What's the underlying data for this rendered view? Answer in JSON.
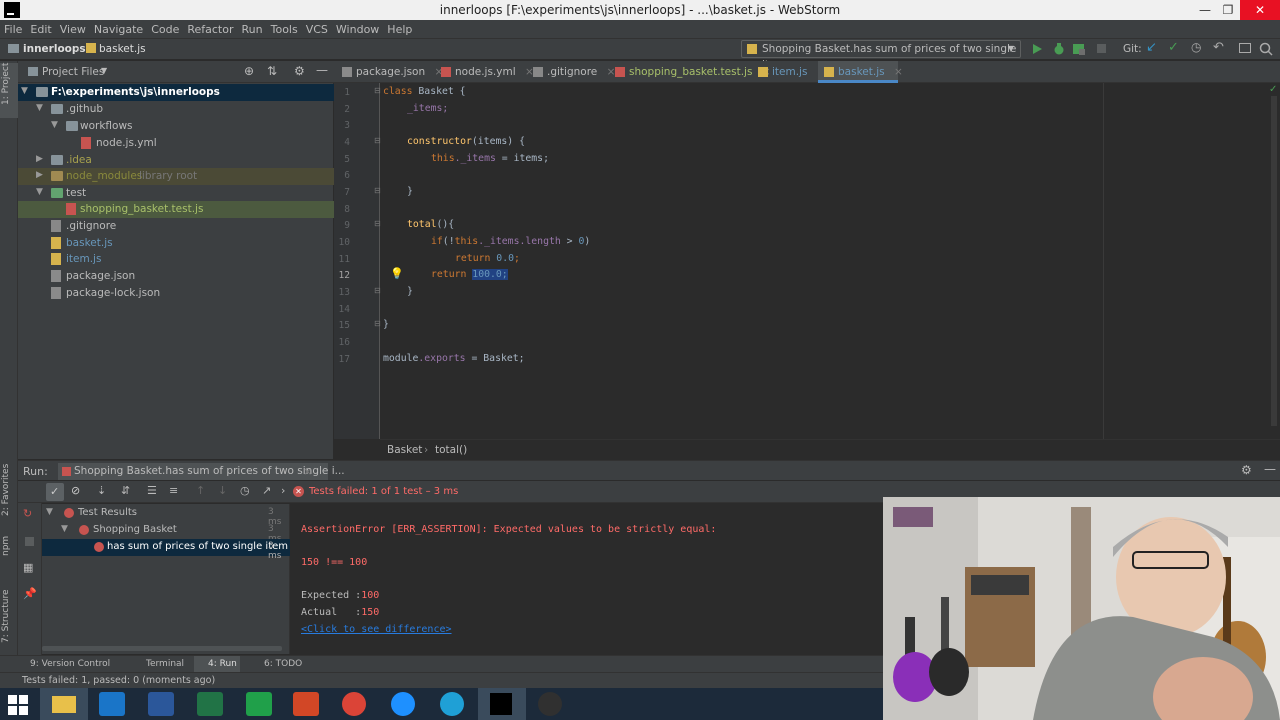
{
  "window": {
    "title": "innerloops [F:\\experiments\\js\\innerloops] - ...\\basket.js - WebStorm",
    "minimize": "—",
    "maximize": "❐",
    "close": "✕"
  },
  "menu": [
    "File",
    "Edit",
    "View",
    "Navigate",
    "Code",
    "Refactor",
    "Run",
    "Tools",
    "VCS",
    "Window",
    "Help"
  ],
  "navbar": {
    "breadcrumb_project": "innerloops",
    "breadcrumb_file": "basket.js",
    "run_config": "Shopping Basket.has sum of prices of two single items",
    "git_label": "Git:"
  },
  "left_strip": {
    "project": "1: Project",
    "favorites": "2: Favorites",
    "npm": "npm",
    "structure": "7: Structure"
  },
  "project": {
    "header": "Project Files",
    "tree": [
      {
        "label": "F:\\experiments\\js\\innerloops",
        "arrow": "▼"
      },
      {
        "label": ".github",
        "arrow": "▼"
      },
      {
        "label": "workflows",
        "arrow": "▼"
      },
      {
        "label": "node.js.yml",
        "arrow": ""
      },
      {
        "label": ".idea",
        "arrow": "▶"
      },
      {
        "label": "node_modules",
        "suffix": "library root",
        "arrow": "▶"
      },
      {
        "label": "test",
        "arrow": "▼"
      },
      {
        "label": "shopping_basket.test.js",
        "arrow": ""
      },
      {
        "label": ".gitignore",
        "arrow": ""
      },
      {
        "label": "basket.js",
        "arrow": ""
      },
      {
        "label": "item.js",
        "arrow": ""
      },
      {
        "label": "package.json",
        "arrow": ""
      },
      {
        "label": "package-lock.json",
        "arrow": ""
      }
    ]
  },
  "tabs": [
    "package.json",
    "node.js.yml",
    ".gitignore",
    "shopping_basket.test.js",
    "item.js",
    "basket.js"
  ],
  "editor": {
    "line_numbers": [
      "1",
      "2",
      "3",
      "4",
      "5",
      "6",
      "7",
      "8",
      "9",
      "10",
      "11",
      "12",
      "13",
      "14",
      "15",
      "16",
      "17"
    ],
    "lines": {
      "l1_kw": "class",
      "l1_rest": " Basket {",
      "l2": "_items;",
      "l4_fn": "constructor",
      "l4_rest": "(items) {",
      "l5_kw": "this",
      "l5_prop": "._items",
      "l5_rest": " = items;",
      "l7": "}",
      "l9_fn": "total",
      "l9_rest": "(){",
      "l10_kw": "if",
      "l10_a": "(!",
      "l10_this": "this",
      "l10_prop": "._items.length",
      "l10_b": " > ",
      "l10_num": "0",
      "l10_c": ")",
      "l11_kw": "return",
      "l11_num": "0.0",
      "l11_end": ";",
      "l12_kw": "return",
      "l12_sel": "100.0;",
      "l13": "}",
      "l15": "}",
      "l17_a": "module",
      "l17_prop": ".exports",
      "l17_b": " = Basket;"
    },
    "breadcrumb_class": "Basket",
    "breadcrumb_method": "total()"
  },
  "run": {
    "label": "Run:",
    "config": "Shopping Basket.has sum of prices of two single i...",
    "status": "Tests failed: 1 of 1 test – 3 ms",
    "tree": [
      {
        "label": "Test Results",
        "time": "3 ms"
      },
      {
        "label": "Shopping Basket",
        "time": "3 ms"
      },
      {
        "label": "has sum of prices of two single item",
        "time": "3 ms"
      }
    ],
    "console": {
      "error": "AssertionError [ERR_ASSERTION]: Expected values to be strictly equal:",
      "compare": "150 !== 100",
      "expected_label": "Expected :",
      "expected_value": "100",
      "actual_label": "Actual   :",
      "actual_value": "150",
      "diff_link": "<Click to see difference>"
    }
  },
  "toolwindows": [
    "9: Version Control",
    "Terminal",
    "4: Run",
    "6: TODO"
  ],
  "status": "Tests failed: 1, passed: 0 (moments ago)",
  "colors": {
    "accent": "#4a88c7",
    "error": "#ff6b68",
    "keyword": "#cc7832",
    "selection": "#214283"
  }
}
